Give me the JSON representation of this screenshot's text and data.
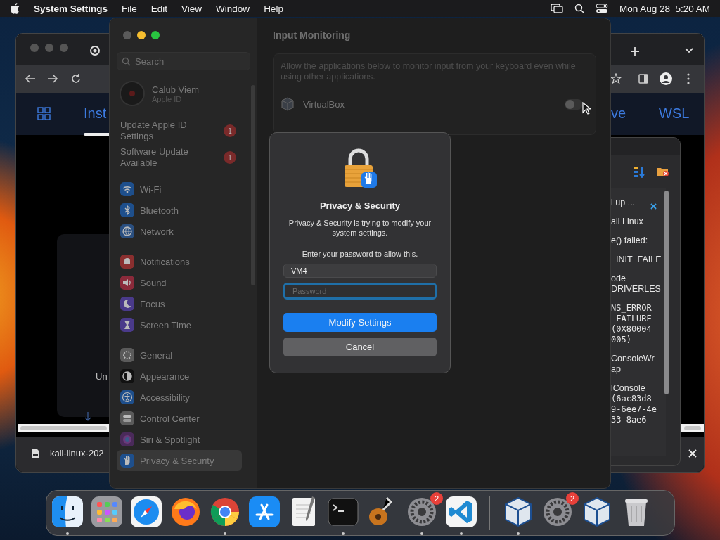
{
  "menu_bar": {
    "app_name": "System Settings",
    "menus": [
      "File",
      "Edit",
      "View",
      "Window",
      "Help"
    ],
    "clock": "Mon Aug 28  5:20 AM"
  },
  "browser": {
    "nav_items": [
      "Inst",
      "ve",
      "WSL"
    ],
    "page_text": "Un",
    "download_file": "kali-linux-202"
  },
  "log_panel": {
    "entries": [
      {
        "lines": [
          {
            "text": "l up ...",
            "kind": "sans"
          }
        ]
      },
      {
        "lines": [
          {
            "text": "ali Linux",
            "kind": "sans"
          }
        ]
      },
      {
        "lines": [
          {
            "text": "e() failed:",
            "kind": "sans"
          }
        ]
      },
      {
        "lines": [
          {
            "text": "_INIT_FAILE",
            "kind": "sans"
          }
        ]
      },
      {
        "lines": [
          {
            "text": "ode",
            "kind": "sans"
          },
          {
            "text": "DRIVERLES",
            "kind": "sans"
          }
        ]
      },
      {
        "lines": [
          {
            "text": "NS_ERROR",
            "kind": "mono"
          },
          {
            "text": "_FAILURE",
            "kind": "mono"
          },
          {
            "text": "(0X80004",
            "kind": "mono"
          },
          {
            "text": "005)",
            "kind": "mono"
          }
        ]
      },
      {
        "lines": [
          {
            "text": "ConsoleWr",
            "kind": "sans"
          },
          {
            "text": "ap",
            "kind": "sans"
          }
        ]
      },
      {
        "lines": [
          {
            "text": "lConsole",
            "kind": "sans"
          },
          {
            "text": "(6ac83d8",
            "kind": "mono"
          },
          {
            "text": "9-6ee7-4e",
            "kind": "mono"
          },
          {
            "text": "33-8ae6-",
            "kind": "mono"
          }
        ]
      }
    ]
  },
  "settings": {
    "search_placeholder": "Search",
    "account": {
      "name": "Calub Viem",
      "subtitle": "Apple ID"
    },
    "notices": [
      {
        "label": "Update Apple ID Settings",
        "badge": "1"
      },
      {
        "label": "Software Update Available",
        "badge": "1"
      }
    ],
    "groups": [
      {
        "items": [
          {
            "label": "Wi-Fi",
            "kind": "wifi",
            "color": "#1e4f8c",
            "selected": false
          },
          {
            "label": "Bluetooth",
            "kind": "bluetooth",
            "color": "#1e4f8c",
            "selected": false
          },
          {
            "label": "Network",
            "kind": "network",
            "color": "#2a4f80",
            "selected": false
          }
        ]
      },
      {
        "items": [
          {
            "label": "Notifications",
            "kind": "notifications",
            "color": "#8a2f2f",
            "selected": false
          },
          {
            "label": "Sound",
            "kind": "sound",
            "color": "#8a2a3a",
            "selected": false
          },
          {
            "label": "Focus",
            "kind": "focus",
            "color": "#4a3a8a",
            "selected": false
          },
          {
            "label": "Screen Time",
            "kind": "screentime",
            "color": "#4a3a8a",
            "selected": false
          }
        ]
      },
      {
        "items": [
          {
            "label": "General",
            "kind": "general",
            "color": "#5a5a5a",
            "selected": false
          },
          {
            "label": "Appearance",
            "kind": "appearance",
            "color": "#111111",
            "selected": false
          },
          {
            "label": "Accessibility",
            "kind": "accessibility",
            "color": "#1e4f8c",
            "selected": false
          },
          {
            "label": "Control Center",
            "kind": "controlcenter",
            "color": "#5a5a5a",
            "selected": false
          },
          {
            "label": "Siri & Spotlight",
            "kind": "siri",
            "color": "#4a2a5a",
            "selected": false
          },
          {
            "label": "Privacy & Security",
            "kind": "privacy",
            "color": "#1e4f8c",
            "selected": true
          }
        ]
      }
    ],
    "content": {
      "title": "Input Monitoring",
      "description": "Allow the applications below to monitor input from your keyboard even while using other applications.",
      "apps": [
        {
          "name": "VirtualBox",
          "on": false
        }
      ]
    }
  },
  "dialog": {
    "title": "Privacy & Security",
    "message": "Privacy & Security is trying to modify your system settings.",
    "prompt": "Enter your password to allow this.",
    "username": "VM4",
    "password_placeholder": "Password",
    "primary_button": "Modify Settings",
    "cancel_button": "Cancel"
  },
  "dock": {
    "items": [
      {
        "kind": "finder",
        "running": true
      },
      {
        "kind": "launchpad",
        "running": false
      },
      {
        "kind": "safari",
        "running": false
      },
      {
        "kind": "firefox",
        "running": false
      },
      {
        "kind": "chrome",
        "running": true
      },
      {
        "kind": "appstore",
        "running": false
      },
      {
        "kind": "textedit",
        "running": false
      },
      {
        "kind": "terminal",
        "running": true
      },
      {
        "kind": "guitar",
        "running": false
      },
      {
        "kind": "settings",
        "running": true,
        "badge": "2"
      },
      {
        "kind": "vscode",
        "running": true
      },
      {
        "kind": "divider"
      },
      {
        "kind": "cube",
        "running": true
      },
      {
        "kind": "settings",
        "running": false,
        "badge": "2"
      },
      {
        "kind": "cube",
        "running": false
      },
      {
        "kind": "trash",
        "running": false
      }
    ]
  }
}
